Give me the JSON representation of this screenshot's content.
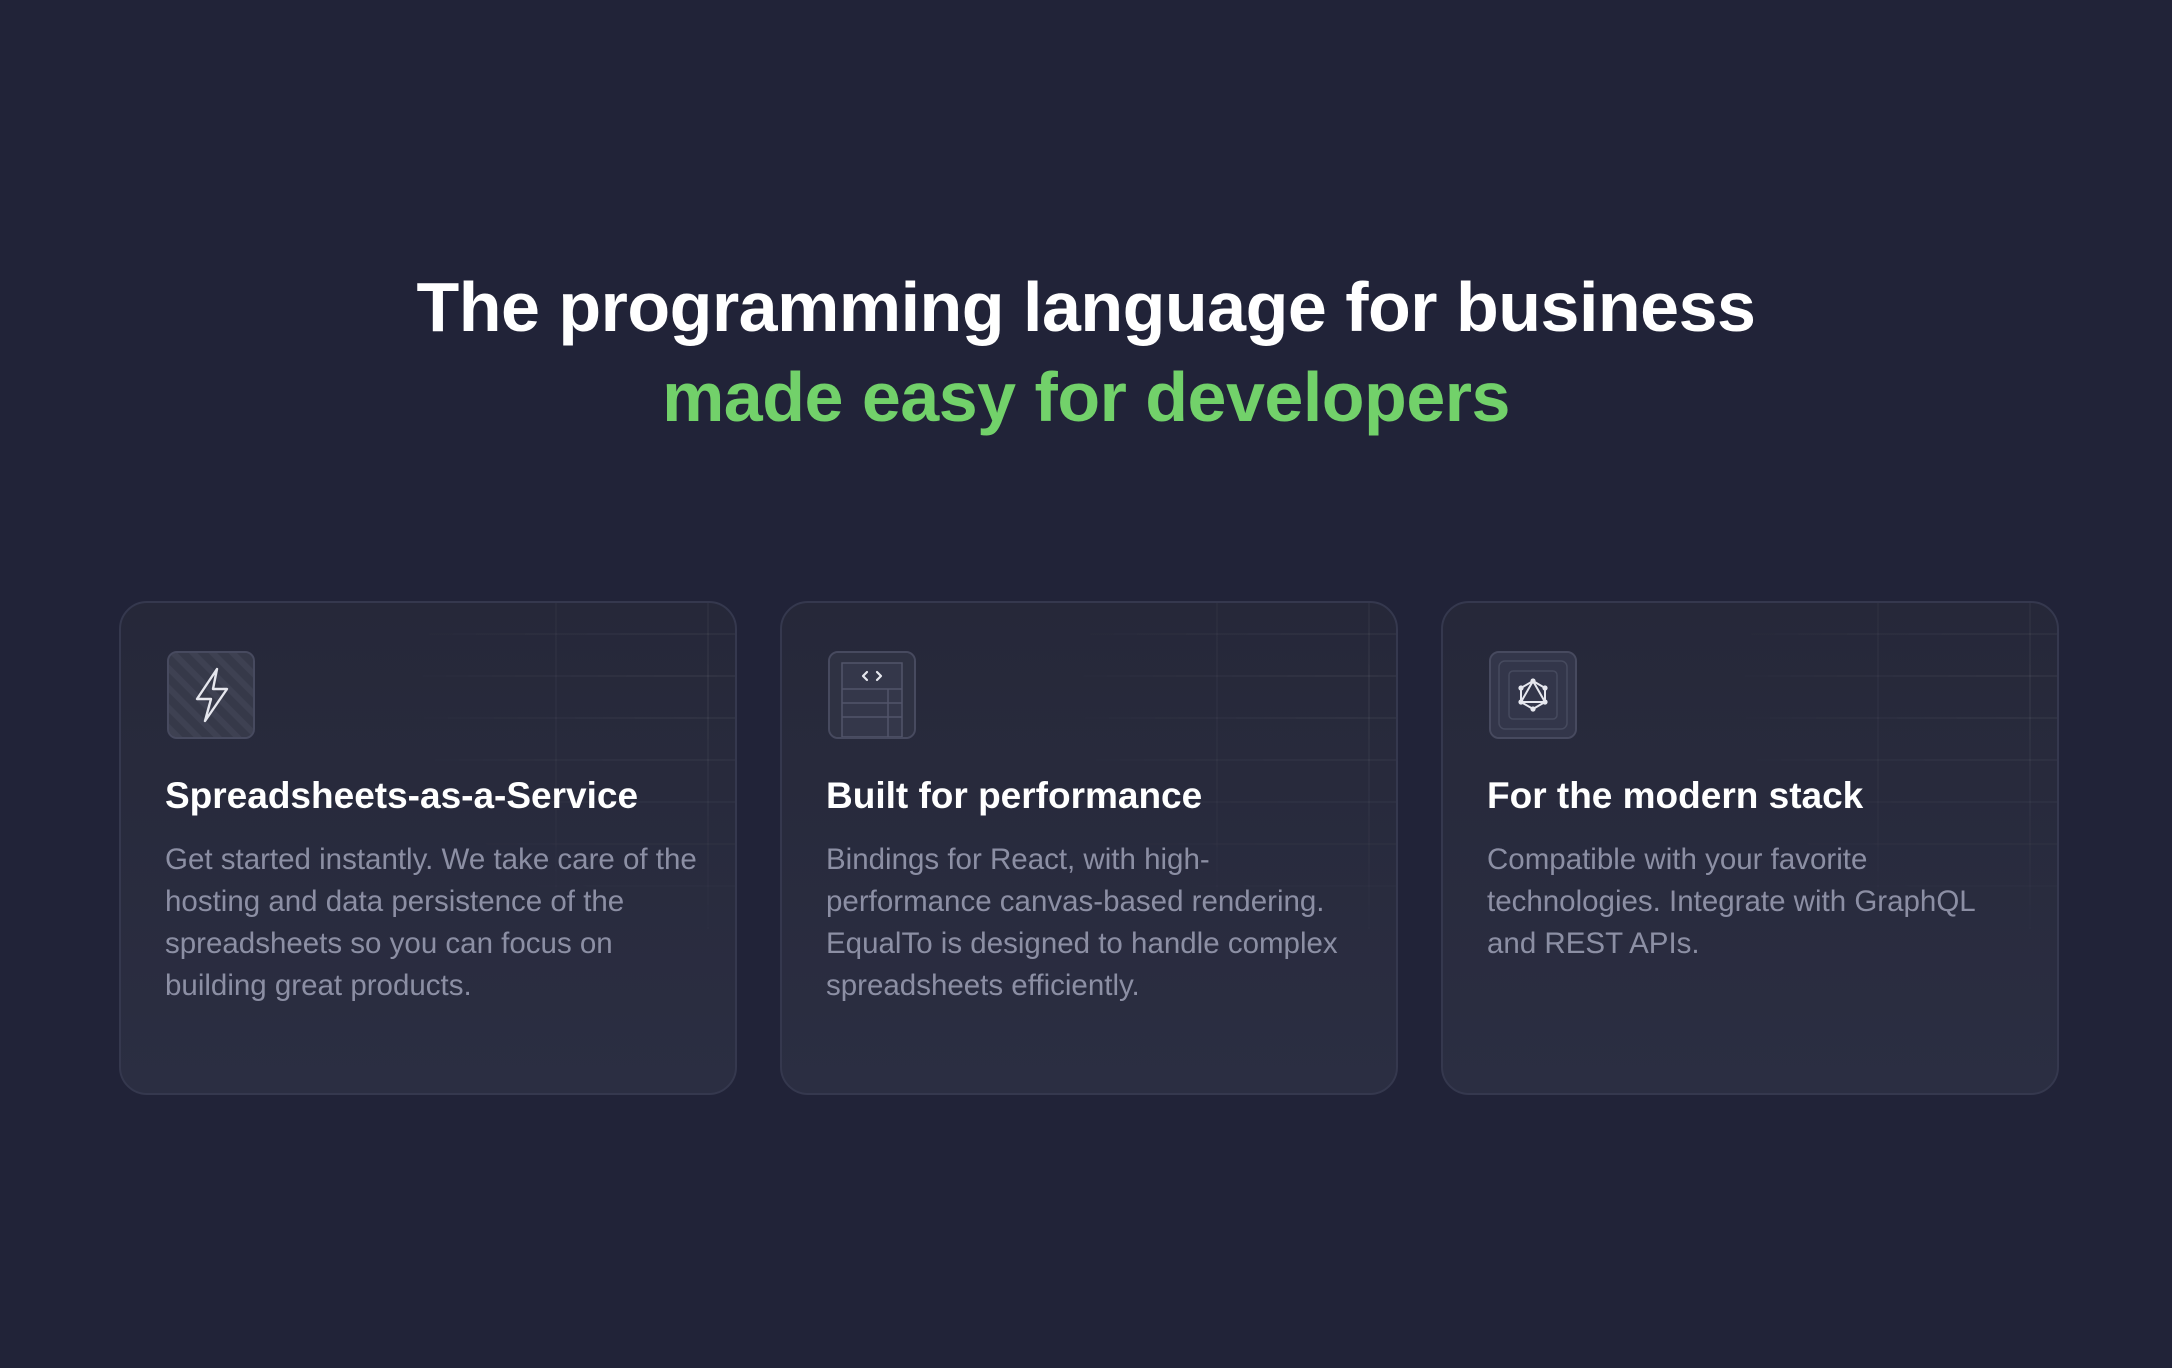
{
  "hero": {
    "title_line1": "The programming language for business",
    "title_line2": "made easy for developers"
  },
  "colors": {
    "background": "#212338",
    "accent_green": "#72d16a",
    "card_text": "#8c8fa4"
  },
  "features": [
    {
      "icon": "lightning-bolt-icon",
      "title": "Spreadsheets-as-a-Service",
      "description": "Get started instantly. We take care of the hosting and data persistence of the spreadsheets so you can focus on building great products."
    },
    {
      "icon": "code-window-icon",
      "title": "Built for performance",
      "description": "Bindings for React, with high-performance canvas-based rendering. EqualTo is designed to handle complex spreadsheets efficiently."
    },
    {
      "icon": "graphql-icon",
      "title": "For the modern stack",
      "description": "Compatible with your favorite technologies. Integrate with GraphQL and REST APIs."
    }
  ]
}
